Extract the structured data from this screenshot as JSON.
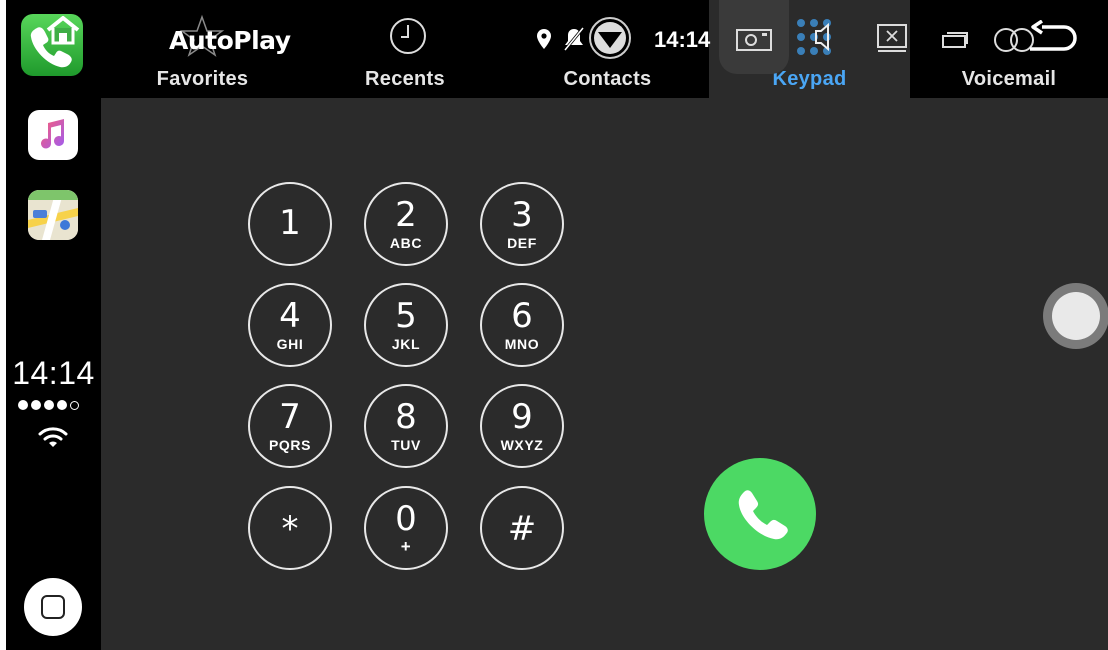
{
  "dock": {
    "apps": [
      {
        "name": "phone-app-icon"
      },
      {
        "name": "music-app-icon"
      },
      {
        "name": "maps-app-icon"
      }
    ],
    "time": "14:14",
    "signal_filled": 4,
    "signal_total": 5
  },
  "header": {
    "app_title": "AutoPlay",
    "status_time": "14:14",
    "tabs": [
      {
        "label": "Favorites",
        "active": false
      },
      {
        "label": "Recents",
        "active": false
      },
      {
        "label": "Contacts",
        "active": false
      },
      {
        "label": "Keypad",
        "active": true
      },
      {
        "label": "Voicemail",
        "active": false
      }
    ]
  },
  "keypad": {
    "keys": [
      {
        "digit": "1",
        "letters": ""
      },
      {
        "digit": "2",
        "letters": "ABC"
      },
      {
        "digit": "3",
        "letters": "DEF"
      },
      {
        "digit": "4",
        "letters": "GHI"
      },
      {
        "digit": "5",
        "letters": "JKL"
      },
      {
        "digit": "6",
        "letters": "MNO"
      },
      {
        "digit": "7",
        "letters": "PQRS"
      },
      {
        "digit": "8",
        "letters": "TUV"
      },
      {
        "digit": "9",
        "letters": "WXYZ"
      },
      {
        "digit": "*",
        "letters": ""
      },
      {
        "digit": "0",
        "letters": "+"
      },
      {
        "digit": "#",
        "letters": ""
      }
    ]
  },
  "colors": {
    "accent": "#4aa6f5",
    "call_green": "#4cd964",
    "background": "#2b2b2b"
  }
}
